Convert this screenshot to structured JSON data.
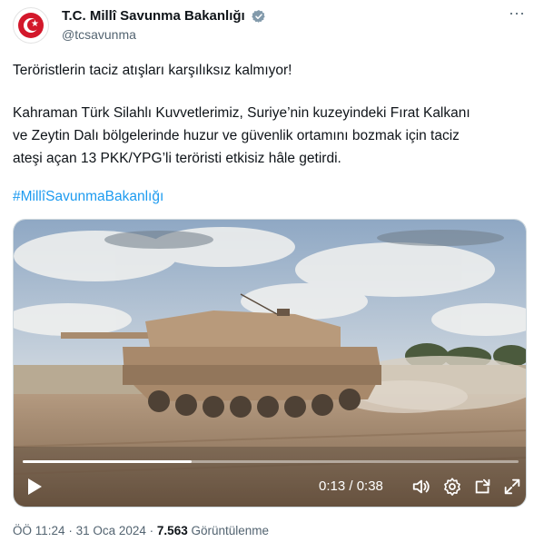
{
  "account": {
    "display_name": "T.C. Millî Savunma Bakanlığı",
    "handle": "@tcsavunma",
    "verified": true
  },
  "tweet": {
    "line1": "Teröristlerin taciz atışları karşılıksız kalmıyor!",
    "para2_line1": "Kahraman Türk Silahlı Kuvvetlerimiz, Suriye’nin kuzeyindeki Fırat Kalkanı",
    "para2_line2": "ve Zeytin Dalı bölgelerinde huzur ve güvenlik ortamını bozmak için taciz",
    "para2_line3": "ateşi açan 13 PKK/YPG’li teröristi etkisiz hâle getirdi.",
    "hashtag": "#MillîSavunmaBakanlığı"
  },
  "video": {
    "current_time": "0:13",
    "duration": "0:38",
    "time_display": "0:13 / 0:38",
    "progress_fraction": 0.34
  },
  "meta": {
    "time": "ÖÖ 11:24",
    "date": "31 Oca 2024",
    "separator": "·",
    "views_count": "7.563",
    "views_label": "Görüntülenme"
  },
  "colors": {
    "accent": "#1d9bf0",
    "verified_badge": "#829aab",
    "logo_red": "#d3182b",
    "secondary_text": "#536471"
  },
  "icons": [
    "more-icon",
    "verified-icon",
    "play-icon",
    "volume-icon",
    "settings-icon",
    "pip-icon",
    "fullscreen-icon"
  ]
}
